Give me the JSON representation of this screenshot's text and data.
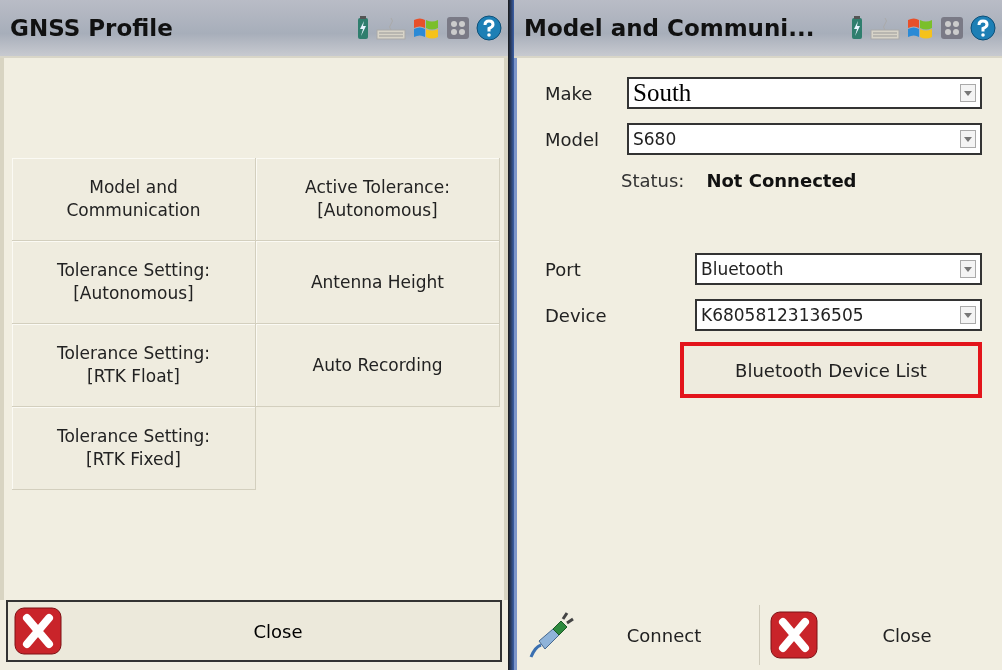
{
  "gnss_profile": {
    "title": "GNSS Profile",
    "menu": [
      {
        "label": "Model and\nCommunication"
      },
      {
        "label": "Active Tolerance:\n[Autonomous]"
      },
      {
        "label": "Tolerance Setting:\n[Autonomous]"
      },
      {
        "label": "Antenna Height"
      },
      {
        "label": "Tolerance Setting:\n[RTK Float]"
      },
      {
        "label": "Auto Recording"
      },
      {
        "label": "Tolerance Setting:\n[RTK Fixed]"
      }
    ],
    "close_button": "Close"
  },
  "model_and_communication": {
    "title": "Model and Communi...",
    "fields": [
      {
        "label": "Make",
        "value": "South",
        "kind": "serif"
      },
      {
        "label": "Model",
        "value": "S680",
        "kind": "plain"
      }
    ],
    "status_label": "Status:",
    "status_value": "Not Connected",
    "port_fields": [
      {
        "label": "Port",
        "value": "Bluetooth"
      },
      {
        "label": "Device",
        "value": "K68058123136505"
      }
    ],
    "device_list_button": {
      "label": "Bluetooth Device List",
      "highlighted": true
    },
    "connect_button": "Connect",
    "close_button": "Close"
  }
}
